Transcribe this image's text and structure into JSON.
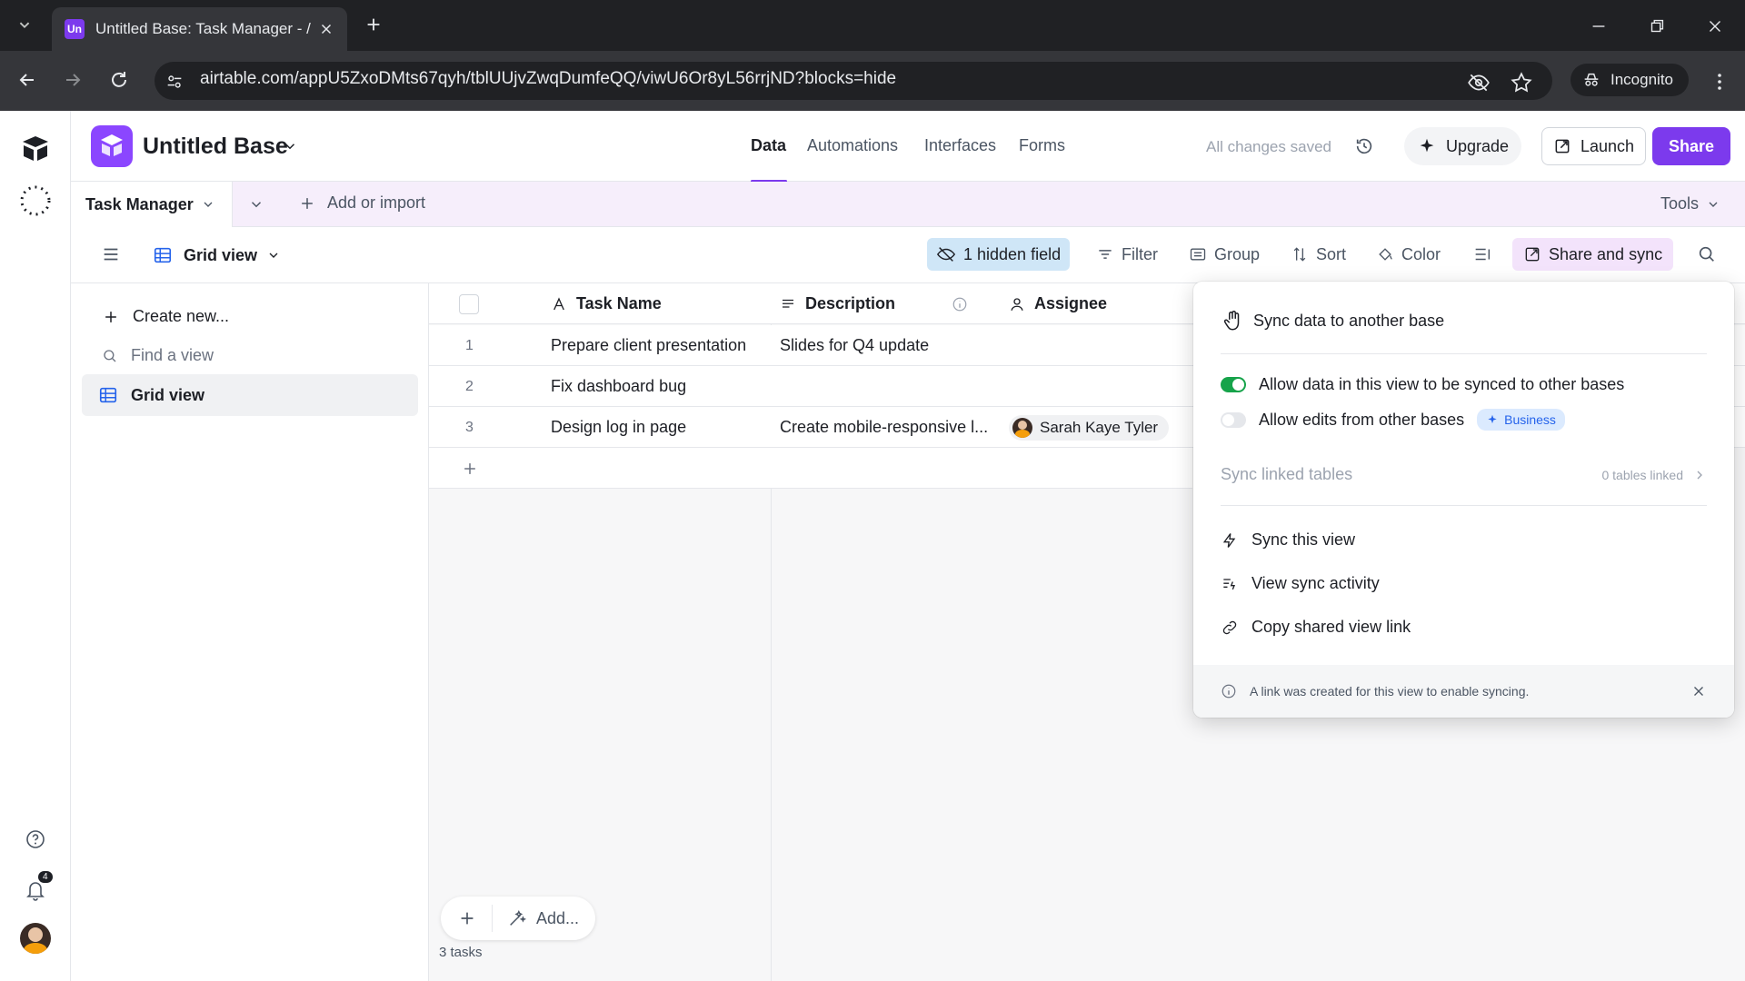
{
  "browser": {
    "tab_title": "Untitled Base: Task Manager - /",
    "tab_favicon": "Un",
    "url": "airtable.com/appU5ZxoDMts67qyh/tblUUjvZwqDumfeQQ/viwU6Or8yL56rrjND?blocks=hide",
    "incognito_label": "Incognito"
  },
  "header": {
    "base_name": "Untitled Base",
    "nav_tabs": [
      "Data",
      "Automations",
      "Interfaces",
      "Forms"
    ],
    "active_tab": "Data",
    "saved_status": "All changes saved",
    "upgrade_label": "Upgrade",
    "launch_label": "Launch",
    "share_label": "Share",
    "accent": "#7c3aed"
  },
  "tablebar": {
    "table_name": "Task Manager",
    "add_import_label": "Add or import",
    "tools_label": "Tools"
  },
  "viewbar": {
    "view_name": "Grid view",
    "hidden_fields_label": "1 hidden field",
    "filter_label": "Filter",
    "group_label": "Group",
    "sort_label": "Sort",
    "color_label": "Color",
    "share_sync_label": "Share and sync"
  },
  "sidebar": {
    "create_new_label": "Create new...",
    "find_view_placeholder": "Find a view",
    "views": [
      "Grid view"
    ]
  },
  "grid": {
    "columns": [
      "Task Name",
      "Description",
      "Assignee"
    ],
    "rows": [
      {
        "num": "1",
        "task": "Prepare client presentation",
        "description": "Slides for Q4 update",
        "assignee": ""
      },
      {
        "num": "2",
        "task": "Fix dashboard bug",
        "description": "",
        "assignee": ""
      },
      {
        "num": "3",
        "task": "Design log in page",
        "description": "Create mobile-responsive l...",
        "assignee": "Sarah Kaye Tyler"
      }
    ],
    "add_label": "Add...",
    "record_count": "3 tasks"
  },
  "popover": {
    "title": "Sync data to another base",
    "allow_sync_label": "Allow data in this view to be synced to other bases",
    "allow_sync_on": true,
    "allow_edits_label": "Allow edits from other bases",
    "allow_edits_on": false,
    "business_badge": "Business",
    "sync_linked_label": "Sync linked tables",
    "tables_linked": "0 tables linked",
    "actions": [
      "Sync this view",
      "View sync activity",
      "Copy shared view link"
    ],
    "footer_note": "A link was created for this view to enable syncing."
  },
  "rail": {
    "notification_count": "4"
  }
}
